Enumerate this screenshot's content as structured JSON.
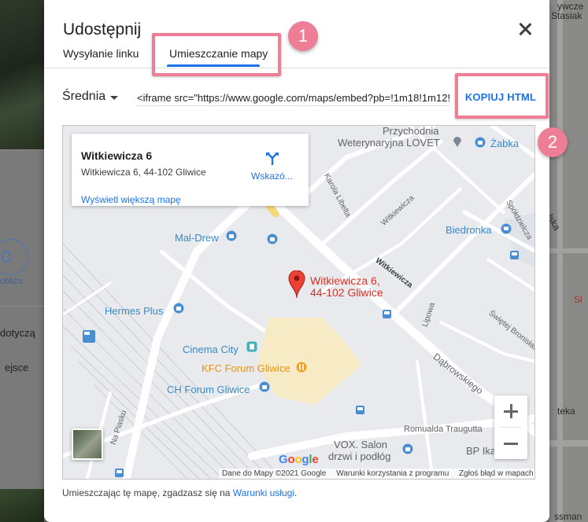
{
  "background": {
    "left_texts": [
      "obliżu",
      "dotyczą",
      "ejsce"
    ],
    "right_texts": [
      "ywcze",
      "Stasiak",
      "lska",
      "Sł",
      "teka",
      "ssman"
    ]
  },
  "dialog": {
    "title": "Udostępnij",
    "tabs": [
      {
        "label": "Wysyłanie linku"
      },
      {
        "label": "Umieszczanie mapy",
        "active": true
      }
    ],
    "size_select": "Średnia",
    "embed_code": "<iframe src=\"https://www.google.com/maps/embed?pb=!1m18!1m12!1m3",
    "copy_button": "KOPIUJ HTML",
    "callouts": [
      "1",
      "2"
    ],
    "footer_text": "Umieszczając tę mapę, zgadzasz się na ",
    "footer_link": "Warunki usługi",
    "footer_end": "."
  },
  "map": {
    "info_card": {
      "title": "Witkiewicza 6",
      "address": "Witkiewicza 6, 44-102 Gliwice",
      "directions": "Wskazó...",
      "larger_map": "Wyświetl większą mapę"
    },
    "marker_label_line1": "Witkiewicza 6,",
    "marker_label_line2": "44-102 Gliwice",
    "places": {
      "przychodnia_line1": "Przychodnia",
      "przychodnia_line2": "Weterynaryjna LOVET",
      "zabka": "Żabka",
      "mal_drew": "Mal-Drew",
      "biedronka": "Biedronka",
      "hermes": "Hermes Plus",
      "cinema": "Cinema City",
      "kfc": "KFC Forum Gliwice",
      "ch_forum": "CH Forum Gliwice",
      "vox_line1": "VOX. Salon",
      "vox_line2": "drzwi i podłóg",
      "bp": "BP Ika"
    },
    "streets": {
      "witkiewicza1": "Witkiewicza",
      "witkiewicza2": "Witkiewicza",
      "karola": "Karola Libelta",
      "dabrowskiego": "Dąbrowskiego",
      "traugutta": "Romualda Traugutta",
      "lipowa": "Lipowa",
      "bronislawy": "Świętej Bronisławy",
      "spoldzielcza": "Spółdzielcza",
      "na_piasku": "Na Piasku"
    },
    "attribution": [
      "Dane do Mapy ©2021 Google",
      "Warunki korzystania z programu",
      "Zgłoś błąd w mapach"
    ],
    "logo_letters": [
      "G",
      "o",
      "o",
      "g",
      "l",
      "e"
    ],
    "logo_colors": [
      "#4285f4",
      "#ea4335",
      "#fbbc05",
      "#4285f4",
      "#34a853",
      "#ea4335"
    ]
  }
}
